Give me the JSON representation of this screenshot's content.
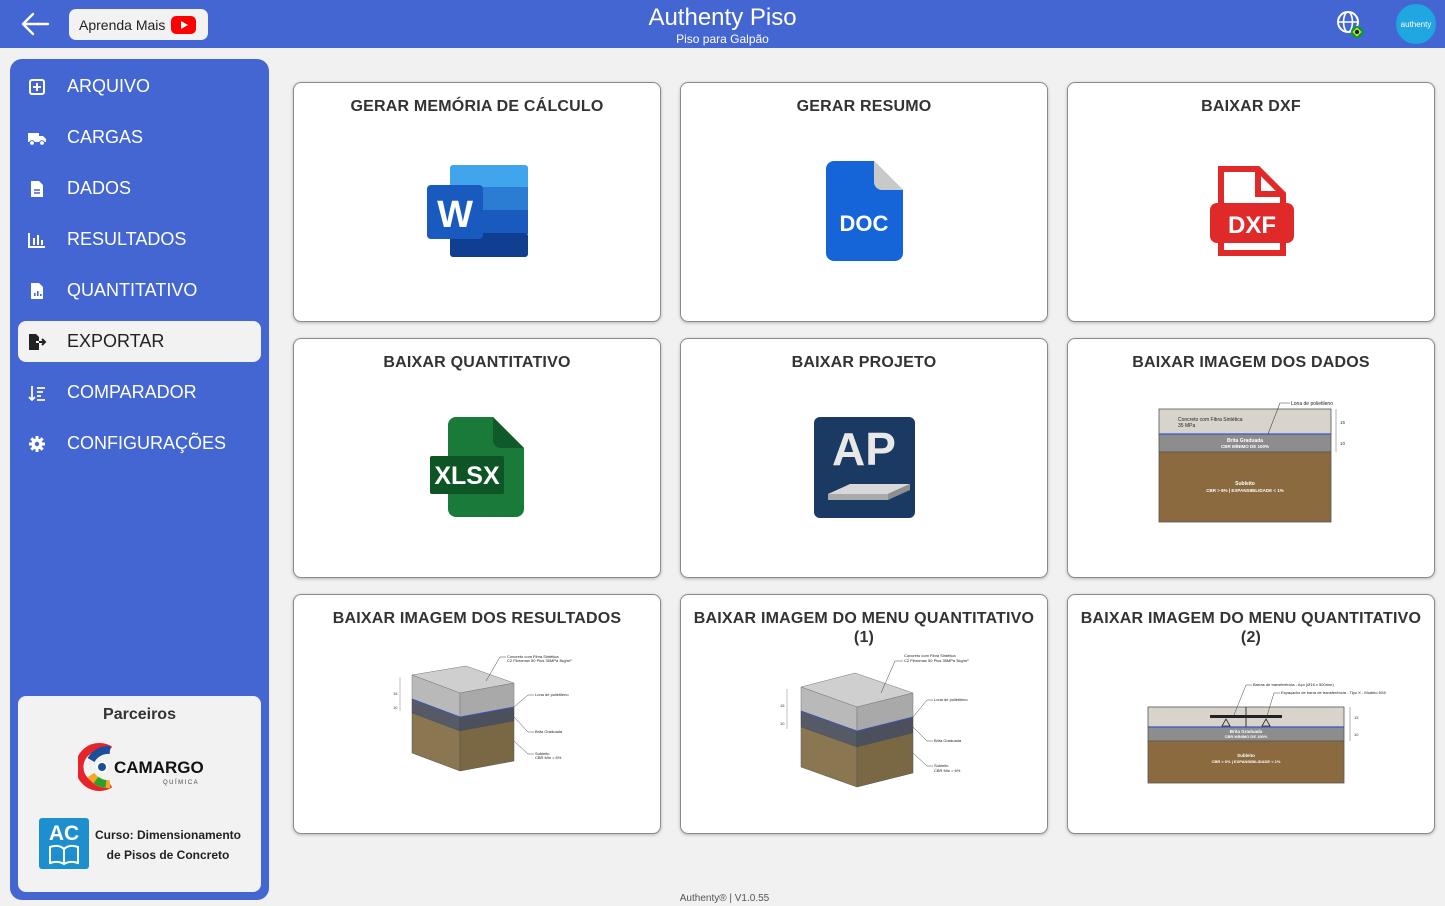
{
  "header": {
    "title": "Authenty Piso",
    "subtitle": "Piso para Galpão",
    "learn_more_label": "Aprenda Mais",
    "avatar_text": "authenty"
  },
  "sidebar": {
    "items": [
      {
        "label": "ARQUIVO",
        "icon": "file-add-icon"
      },
      {
        "label": "CARGAS",
        "icon": "truck-icon"
      },
      {
        "label": "DADOS",
        "icon": "document-icon"
      },
      {
        "label": "RESULTADOS",
        "icon": "bar-chart-icon"
      },
      {
        "label": "QUANTITATIVO",
        "icon": "report-icon"
      },
      {
        "label": "EXPORTAR",
        "icon": "export-icon",
        "active": true
      },
      {
        "label": "COMPARADOR",
        "icon": "sort-icon"
      },
      {
        "label": "CONFIGURAÇÕES",
        "icon": "gear-icon"
      }
    ],
    "partners": {
      "title": "Parceiros",
      "camargo_name": "CAMARGO",
      "camargo_sub": "QUÍMICA",
      "course_logo": "AC",
      "course_line1": "Curso: Dimensionamento",
      "course_line2": "de Pisos de Concreto"
    }
  },
  "cards": [
    {
      "title": "GERAR MEMÓRIA DE CÁLCULO",
      "icon": "word-icon"
    },
    {
      "title": "GERAR RESUMO",
      "icon": "doc-file-icon"
    },
    {
      "title": "BAIXAR DXF",
      "icon": "dxf-file-icon"
    },
    {
      "title": "BAIXAR QUANTITATIVO",
      "icon": "xlsx-file-icon"
    },
    {
      "title": "BAIXAR PROJETO",
      "icon": "ap-project-icon"
    },
    {
      "title": "BAIXAR IMAGEM DOS DADOS",
      "icon": "section-diagram"
    },
    {
      "title": "BAIXAR IMAGEM DOS RESULTADOS",
      "icon": "block-diagram"
    },
    {
      "title": "BAIXAR IMAGEM DO MENU QUANTITATIVO (1)",
      "icon": "block-diagram"
    },
    {
      "title": "BAIXAR IMAGEM DO MENU QUANTITATIVO (2)",
      "icon": "section-diagram"
    }
  ],
  "icon_text": {
    "doc": "DOC",
    "dxf": "DXF",
    "xlsx": "XLSX",
    "ap": "AP",
    "word": "W"
  },
  "diagram_labels": {
    "lona": "Lona de polietileno",
    "concreto": "Concreto com Fibra Sintética",
    "concreto_mpa": "35 MPa",
    "brita": "Brita Graduada",
    "brita_cbr": "CBR MÍNIMO DE 100%",
    "subleito": "Subleito",
    "subleito_cbr": "CBR > 6% | EXPANSIBILIDADE < 1%",
    "dim_15": "15",
    "dim_10": "10",
    "concreto_block": "Concreto com Fibra Sintética",
    "concreto_block_mpa": "C2 Fibromax 50 Plus 35MPa 3kg/m³",
    "lona_block": "Lona de polietileno",
    "brita_block": "Brita Graduada",
    "subleito_block": "Subleito",
    "subleito_block_cbr": "CBR Min = 6%",
    "barras": "Barras de transferência - Aço (Ø16 x 500mm)",
    "espacador": "Espaçador de barra de transferência - Tipo X - Modelo 6X8",
    "subleito_2_cbr": "CBR > 6% | EXPANSIBILIDADE < 1%"
  },
  "footer": {
    "text": "Authenty® | V1.0.55"
  },
  "colors": {
    "primary": "#4466d2",
    "background": "#f1f1f1"
  }
}
